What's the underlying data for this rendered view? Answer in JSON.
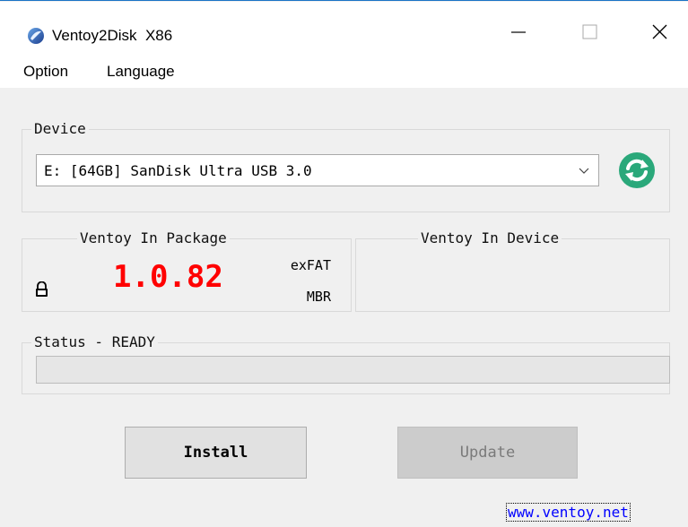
{
  "window": {
    "title": "Ventoy2Disk  X86",
    "controls": [
      "minimize",
      "maximize",
      "close"
    ]
  },
  "menu": {
    "items": [
      {
        "label": "Option"
      },
      {
        "label": "Language"
      }
    ]
  },
  "device": {
    "group_label": "Device",
    "selected": "E: [64GB] SanDisk Ultra USB 3.0",
    "refresh_icon": "refresh-icon"
  },
  "package": {
    "group_label": "Ventoy In Package",
    "version": "1.0.82",
    "filesystem": "exFAT",
    "partition_style": "MBR",
    "lock_icon": "lock-icon"
  },
  "device_info": {
    "group_label": "Ventoy In Device",
    "version": ""
  },
  "status": {
    "label": "Status - READY",
    "progress": 0
  },
  "buttons": {
    "install": "Install",
    "update": "Update"
  },
  "footer": {
    "link": "www.ventoy.net"
  },
  "colors": {
    "accent": "#1a73c6",
    "version": "#ff0000",
    "refresh": "#2aa87a",
    "link": "#0000ff"
  }
}
